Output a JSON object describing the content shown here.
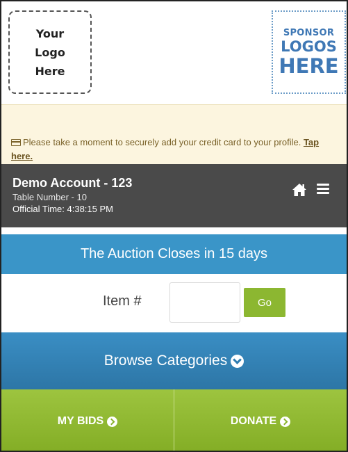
{
  "header": {
    "logo_lines": [
      "Your",
      "Logo",
      "Here"
    ],
    "sponsor_lines": [
      "SPONSOR",
      "LOGOS",
      "HERE"
    ]
  },
  "notice": {
    "icon": "credit-card-icon",
    "text": "Please take a moment to securely add your credit card to your profile.",
    "link": "Tap here."
  },
  "account": {
    "name": "Demo Account - 123",
    "table": "Table Number - 10",
    "official_time": "Official Time: 4:38:15 PM",
    "icons": [
      "home-icon",
      "menu-icon"
    ]
  },
  "auction": {
    "closes_text": "The Auction Closes in 15 days"
  },
  "item_search": {
    "label": "Item #",
    "value": "",
    "go_label": "Go"
  },
  "browse": {
    "label": "Browse Categories",
    "icon": "chevron-down-circle-icon"
  },
  "buttons": {
    "my_bids": "MY BIDS",
    "donate": "DONATE",
    "icon": "chevron-right-circle-icon"
  },
  "colors": {
    "notice_bg": "#fcf5df",
    "account_bg": "#4a4a4a",
    "blue": "#3a95c8",
    "green": "#8cb731"
  }
}
